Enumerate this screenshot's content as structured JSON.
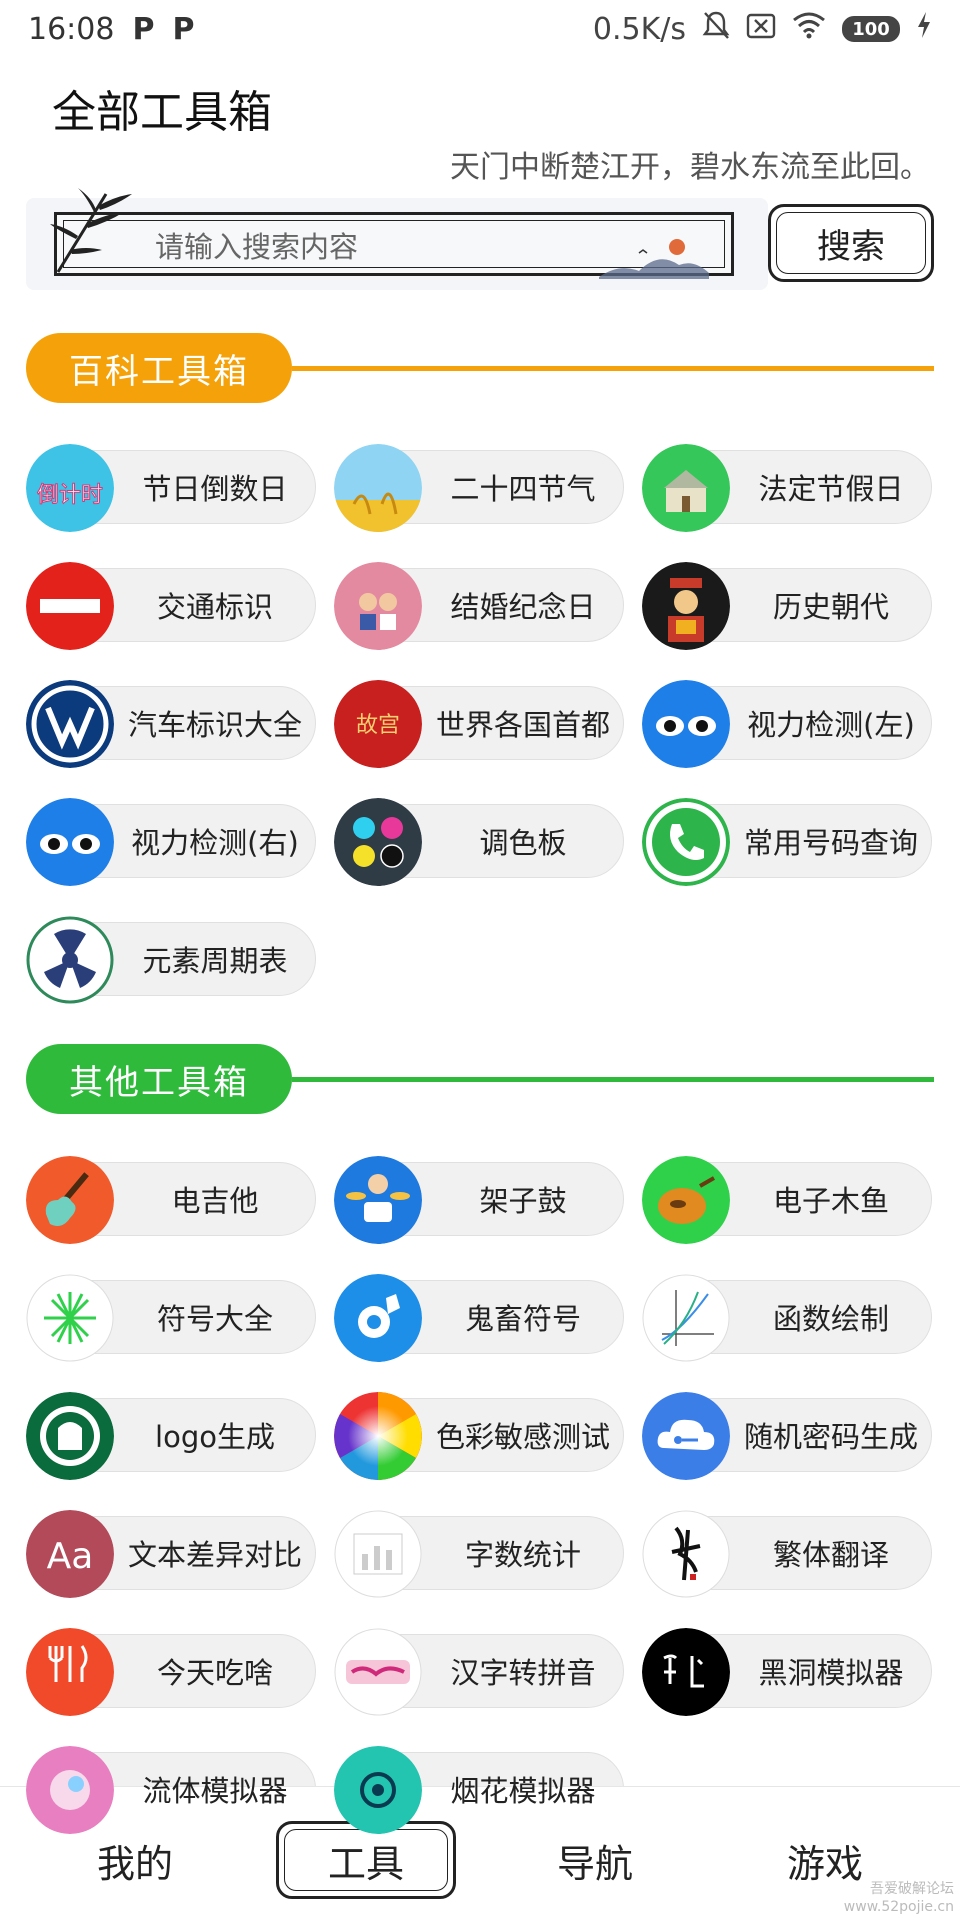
{
  "status_bar": {
    "time": "16:08",
    "notif_icons": [
      "P",
      "P"
    ],
    "network_speed": "0.5K/s",
    "battery": "100"
  },
  "header": {
    "title": "全部工具箱",
    "poem": "天门中断楚江开，碧水东流至此回。"
  },
  "search": {
    "placeholder": "请输入搜索内容",
    "button_label": "搜索"
  },
  "sections": {
    "encyclopedia": {
      "title": "百科工具箱",
      "color": "#f5a20a",
      "items": [
        {
          "label": "节日倒数日",
          "icon": "festival-countdown-icon",
          "color": "#3ec3e6"
        },
        {
          "label": "二十四节气",
          "icon": "solar-terms-icon",
          "color": "#f2c12e"
        },
        {
          "label": "法定节假日",
          "icon": "holiday-icon",
          "color": "#35c759"
        },
        {
          "label": "交通标识",
          "icon": "traffic-sign-icon",
          "color": "#e3231b"
        },
        {
          "label": "结婚纪念日",
          "icon": "wedding-anniversary-icon",
          "color": "#e48aa0"
        },
        {
          "label": "历史朝代",
          "icon": "history-dynasty-icon",
          "color": "#1a1a1a"
        },
        {
          "label": "汽车标识大全",
          "icon": "car-logo-icon",
          "color": "#0b3b7c"
        },
        {
          "label": "世界各国首都",
          "icon": "world-capital-icon",
          "color": "#c81f1f"
        },
        {
          "label": "视力检测(左)",
          "icon": "eye-test-left-icon",
          "color": "#1e7fe8"
        },
        {
          "label": "视力检测(右)",
          "icon": "eye-test-right-icon",
          "color": "#1e7fe8"
        },
        {
          "label": "调色板",
          "icon": "palette-icon",
          "color": "#2f3b45"
        },
        {
          "label": "常用号码查询",
          "icon": "phone-icon",
          "color": "#2db44a"
        },
        {
          "label": "元素周期表",
          "icon": "periodic-table-icon",
          "color": "#2a3f7a"
        }
      ]
    },
    "other": {
      "title": "其他工具箱",
      "color": "#2fba3c",
      "items": [
        {
          "label": "电吉他",
          "icon": "electric-guitar-icon",
          "color": "#f15a2b"
        },
        {
          "label": "架子鼓",
          "icon": "drum-kit-icon",
          "color": "#1f7ae0"
        },
        {
          "label": "电子木鱼",
          "icon": "wooden-fish-icon",
          "color": "#2fd14a"
        },
        {
          "label": "符号大全",
          "icon": "symbols-icon",
          "color": "#ffffff"
        },
        {
          "label": "鬼畜符号",
          "icon": "music-note-icon",
          "color": "#1e8fe8"
        },
        {
          "label": "函数绘制",
          "icon": "function-plot-icon",
          "color": "#ffffff"
        },
        {
          "label": "logo生成",
          "icon": "logo-maker-icon",
          "color": "#0a6b3c"
        },
        {
          "label": "色彩敏感测试",
          "icon": "color-wheel-icon",
          "color": "#8a3fd0"
        },
        {
          "label": "随机密码生成",
          "icon": "password-cloud-icon",
          "color": "#3c7ee8"
        },
        {
          "label": "文本差异对比",
          "icon": "text-diff-icon",
          "color": "#b34a5a"
        },
        {
          "label": "字数统计",
          "icon": "word-count-icon",
          "color": "#ffffff"
        },
        {
          "label": "繁体翻译",
          "icon": "traditional-chinese-icon",
          "color": "#ffffff"
        },
        {
          "label": "今天吃啥",
          "icon": "food-icon",
          "color": "#f04a2b"
        },
        {
          "label": "汉字转拼音",
          "icon": "pinyin-icon",
          "color": "#ffffff"
        },
        {
          "label": "黑洞模拟器",
          "icon": "black-hole-icon",
          "color": "#000000"
        },
        {
          "label": "流体模拟器",
          "icon": "fluid-icon",
          "color": "#e87fc0"
        },
        {
          "label": "烟花模拟器",
          "icon": "fireworks-icon",
          "color": "#23c4b0"
        }
      ]
    }
  },
  "bottom_nav": {
    "items": [
      {
        "label": "我的"
      },
      {
        "label": "工具"
      },
      {
        "label": "导航"
      },
      {
        "label": "游戏"
      }
    ],
    "active_index": 1
  },
  "watermark": "吾爱破解论坛\nwww.52pojie.cn"
}
